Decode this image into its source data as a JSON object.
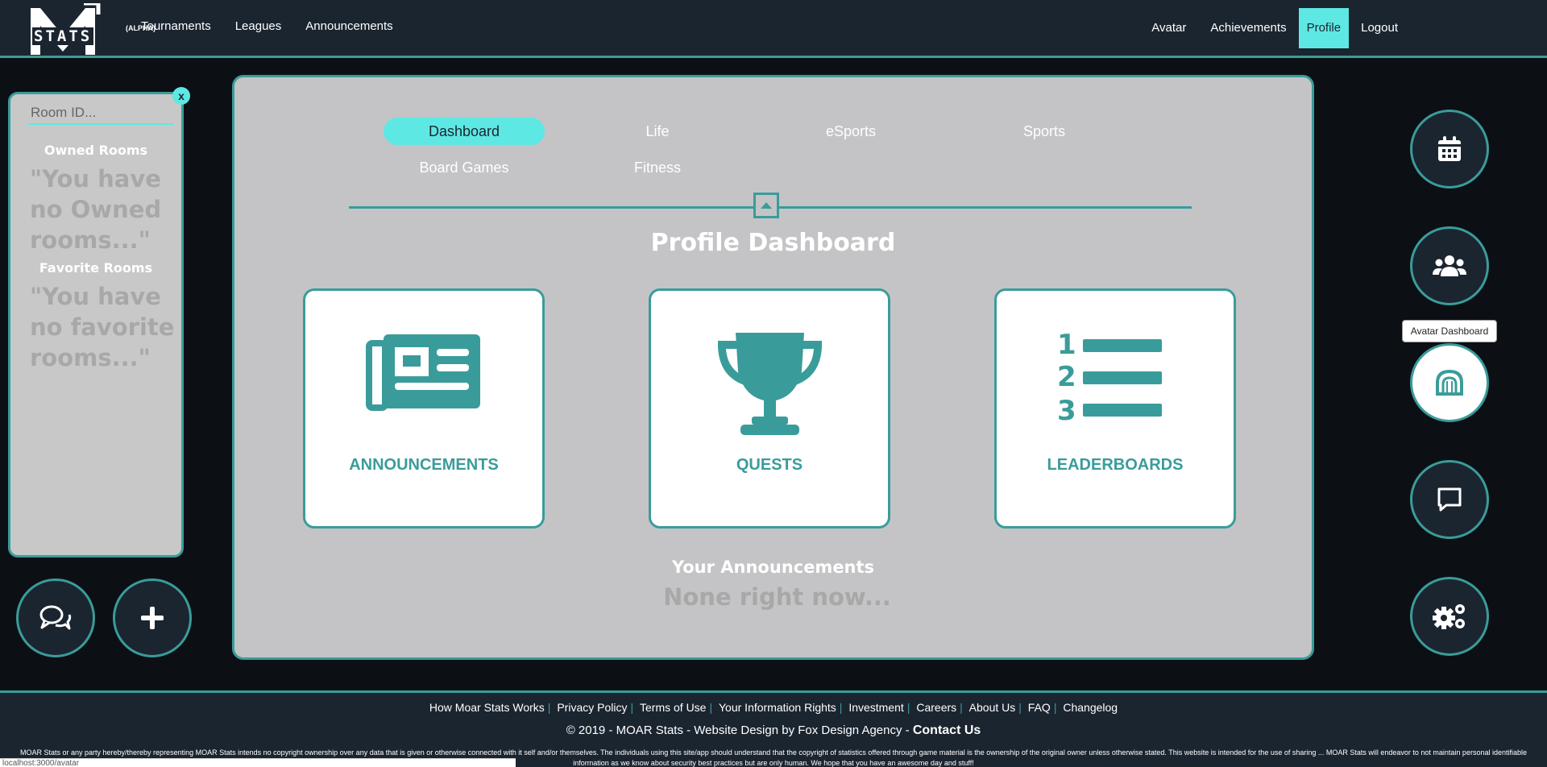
{
  "brand": {
    "logo_text": "STATS",
    "alpha_label": "(ALPHA)"
  },
  "nav": {
    "left": [
      "Tournaments",
      "Leagues",
      "Announcements"
    ],
    "right": [
      "Avatar",
      "Achievements",
      "Profile",
      "Logout"
    ],
    "active": "Profile"
  },
  "rooms": {
    "search_placeholder": "Room ID...",
    "close_label": "x",
    "owned_heading": "Owned Rooms",
    "owned_empty": "\"You have no Owned rooms...\"",
    "favorite_heading": "Favorite Rooms",
    "favorite_empty": "\"You have no favorite rooms...\""
  },
  "tabs": [
    "Dashboard",
    "Life",
    "eSports",
    "Sports",
    "Board Games",
    "Fitness"
  ],
  "active_tab": "Dashboard",
  "dashboard": {
    "title": "Profile Dashboard",
    "cards": [
      {
        "label": "ANNOUNCEMENTS",
        "icon": "newspaper-icon"
      },
      {
        "label": "QUESTS",
        "icon": "trophy-icon"
      },
      {
        "label": "LEADERBOARDS",
        "icon": "ranked-list-icon"
      }
    ],
    "announcements_heading": "Your Announcements",
    "announcements_empty": "None right now..."
  },
  "side_buttons": [
    {
      "icon": "calendar-icon"
    },
    {
      "icon": "users-icon"
    },
    {
      "icon": "avatar-dashboard-icon",
      "tooltip": "Avatar Dashboard"
    },
    {
      "icon": "chat-icon"
    },
    {
      "icon": "settings-icon"
    }
  ],
  "left_buttons": [
    {
      "icon": "comments-icon"
    },
    {
      "icon": "plus-icon"
    }
  ],
  "footer": {
    "links": [
      "How Moar Stats Works",
      "Privacy Policy",
      "Terms of Use",
      "Your Information Rights",
      "Investment",
      "Careers",
      "About Us",
      "FAQ",
      "Changelog"
    ],
    "copyright": "© 2019 - MOAR Stats - ",
    "design_prefix": "Website Design by ",
    "agency": "Fox Design Agency",
    "contact": "Contact Us",
    "legal": "MOAR Stats or any party hereby/thereby representing MOAR Stats intends no copyright ownership over any data that is given or otherwise connected with it self and/or themselves. The individuals using this site/app should understand that the copyright of statistics offered through game material is the ownership of the original owner unless otherwise stated. This website is intended for the use of sharing ... MOAR Stats will endeavor to not maintain personal identifiable information as we know about security best practices but are only human. We hope that you have an awesome day and stuff!"
  },
  "status_url": "localhost:3000/avatar",
  "colors": {
    "accent": "#5ee8e3",
    "teal": "#3a9c9a",
    "dark": "#1b2530",
    "panel": "#c4c4c6"
  }
}
